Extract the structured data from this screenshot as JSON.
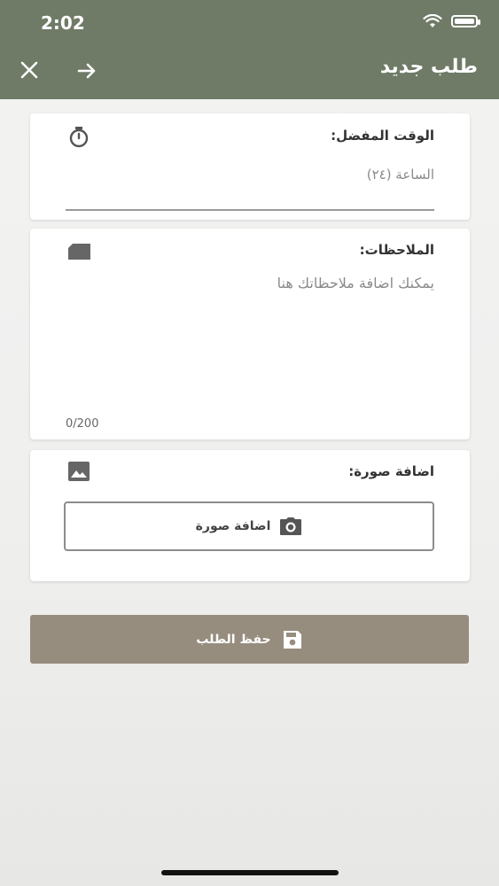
{
  "status_bar": {
    "time": "2:02"
  },
  "header": {
    "title": "طلب جديد"
  },
  "time_field": {
    "label": "الوقت المفضل:",
    "placeholder": "الساعة (٢٤)"
  },
  "notes_field": {
    "label": "الملاحظات:",
    "placeholder": "يمكنك اضافة ملاحظاتك هنا",
    "counter": "0/200"
  },
  "photo_field": {
    "label": "اضافة صورة:",
    "button_label": "اضافة صورة"
  },
  "save_button": {
    "label": "حفظ الطلب"
  },
  "icons": {
    "status": [
      "wifi-icon",
      "battery-icon"
    ],
    "nav": [
      "close-icon",
      "arrow-right-icon"
    ],
    "fields": [
      "timer-icon",
      "note-icon",
      "image-icon",
      "camera-icon",
      "save-icon"
    ]
  },
  "colors": {
    "header": "#6f7b67",
    "save_button": "#968d7e",
    "card": "#ffffff"
  }
}
